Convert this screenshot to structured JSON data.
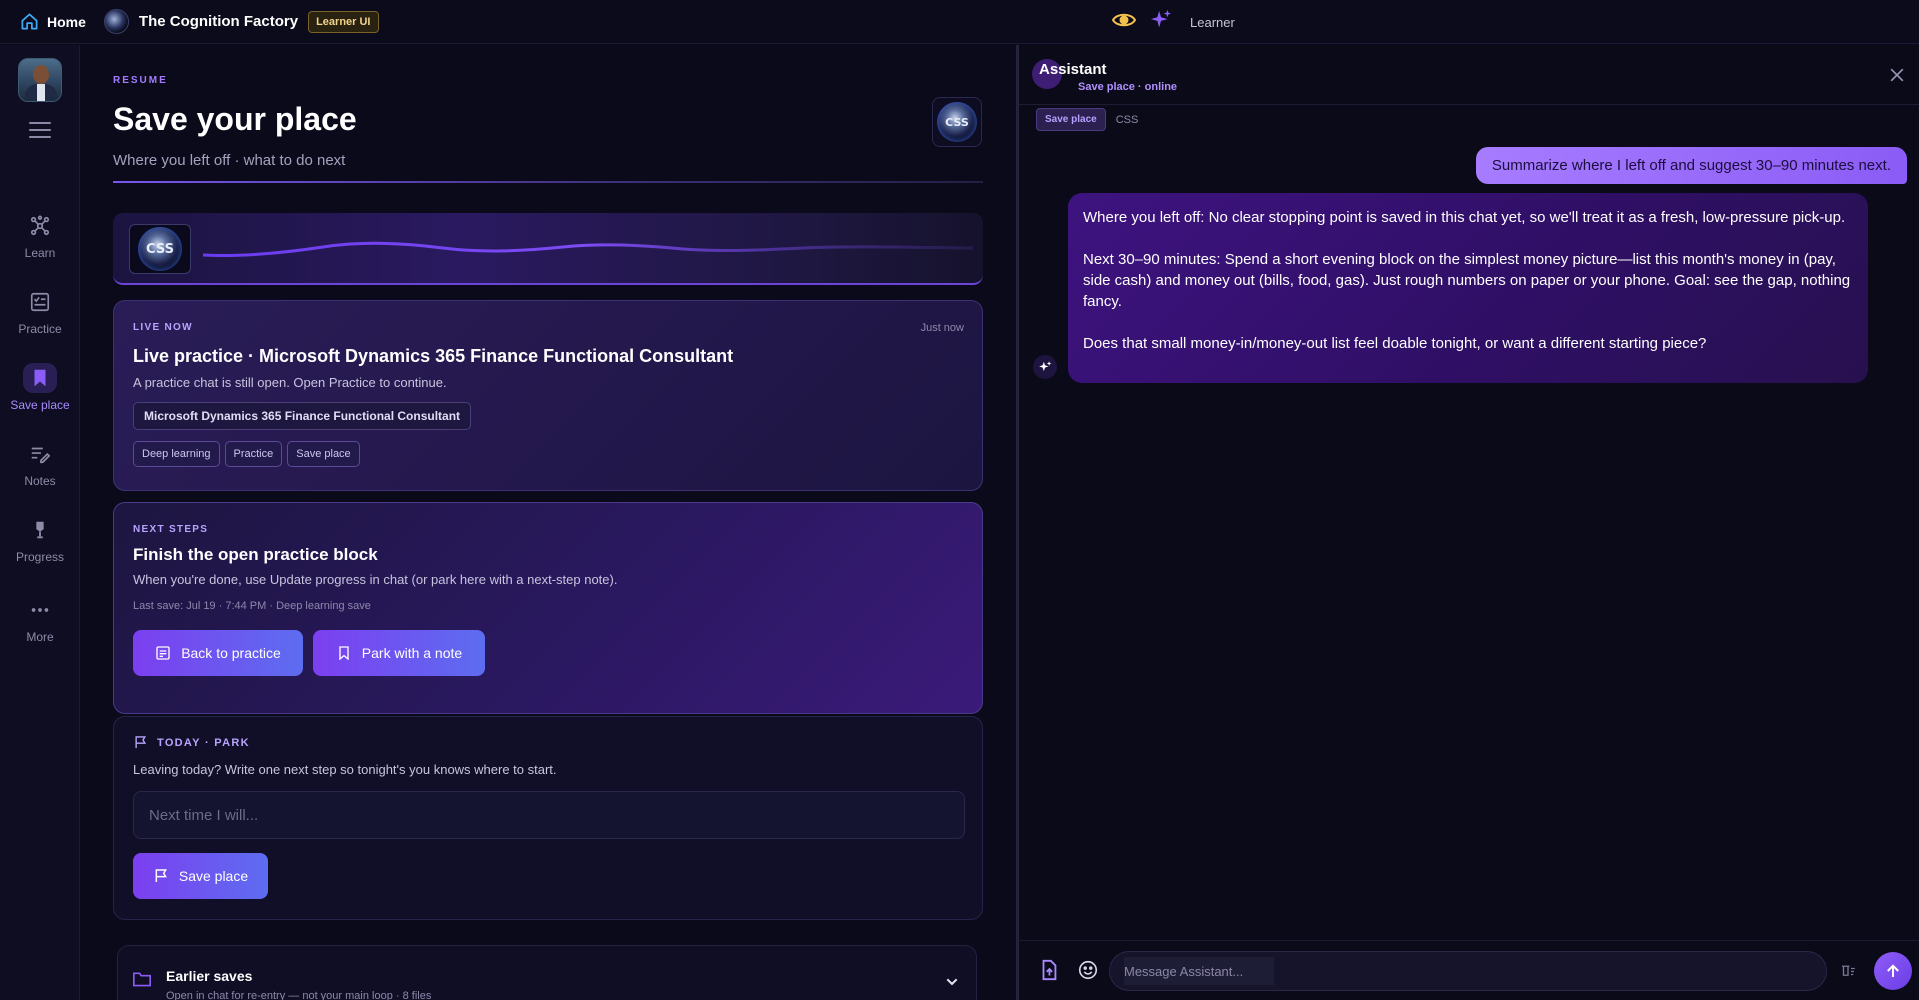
{
  "topbar": {
    "home_label": "Home",
    "brand_name": "The Cognition Factory",
    "brand_badge": "Learner UI",
    "role_label": "Learner"
  },
  "leftnav": {
    "items": [
      {
        "label": "Learn",
        "icon": "hub-icon"
      },
      {
        "label": "Practice",
        "icon": "checklist-icon"
      },
      {
        "label": "Save place",
        "icon": "bookmark-icon",
        "active": true
      },
      {
        "label": "Notes",
        "icon": "notes-icon"
      },
      {
        "label": "Progress",
        "icon": "trophy-icon"
      },
      {
        "label": "More",
        "icon": "more-dots-icon"
      }
    ]
  },
  "main": {
    "eyebrow": "RESUME",
    "title": "Save your place",
    "subtitle": "Where you left off · what to do next",
    "logo_text": "CSS",
    "live": {
      "kicker": "LIVE NOW",
      "timestamp": "Just now",
      "title": "Live practice · Microsoft Dynamics 365 Finance Functional Consultant",
      "body": "A practice chat is still open. Open Practice to continue.",
      "course_chip": "Microsoft Dynamics 365 Finance Functional Consultant",
      "tags": [
        "Deep learning",
        "Practice",
        "Save place"
      ]
    },
    "next": {
      "kicker": "NEXT STEPS",
      "title": "Finish the open practice block",
      "body": "When you're done, use Update progress in chat (or park here with a next-step note).",
      "meta": "Last save: Jul 19 · 7:44 PM · Deep learning save",
      "btn_back": "Back to practice",
      "btn_park": "Park with a note"
    },
    "park": {
      "kicker": "TODAY · PARK",
      "body": "Leaving today? Write one next step so tonight's you knows where to start.",
      "input_placeholder": "Next time I will...",
      "btn_save": "Save place"
    },
    "earlier": {
      "title": "Earlier saves",
      "subtitle": "Open in chat for re-entry — not your main loop · 8 files"
    }
  },
  "assistant": {
    "title": "Assistant",
    "status": "Save place · online",
    "tag_active": "Save place",
    "tag_plain": "CSS",
    "user_message": "Summarize where I left off and suggest 30–90 minutes next.",
    "ai_paragraphs": [
      "Where you left off: No clear stopping point is saved in this chat yet, so we'll treat it as a fresh, low-pressure pick-up.",
      "Next 30–90 minutes: Spend a short evening block on the simplest money picture—list this month's money in (pay, side cash) and money out (bills, food, gas). Just rough numbers on paper or your phone. Goal: see the gap, nothing fancy.",
      "Does that small money-in/money-out list feel doable tonight, or want a different starting piece?"
    ],
    "composer_placeholder": "Message Assistant..."
  },
  "colors": {
    "accent": "#8b5cf6",
    "brand_blue": "#5d6df0",
    "badge_gold": "#f1d38a"
  }
}
